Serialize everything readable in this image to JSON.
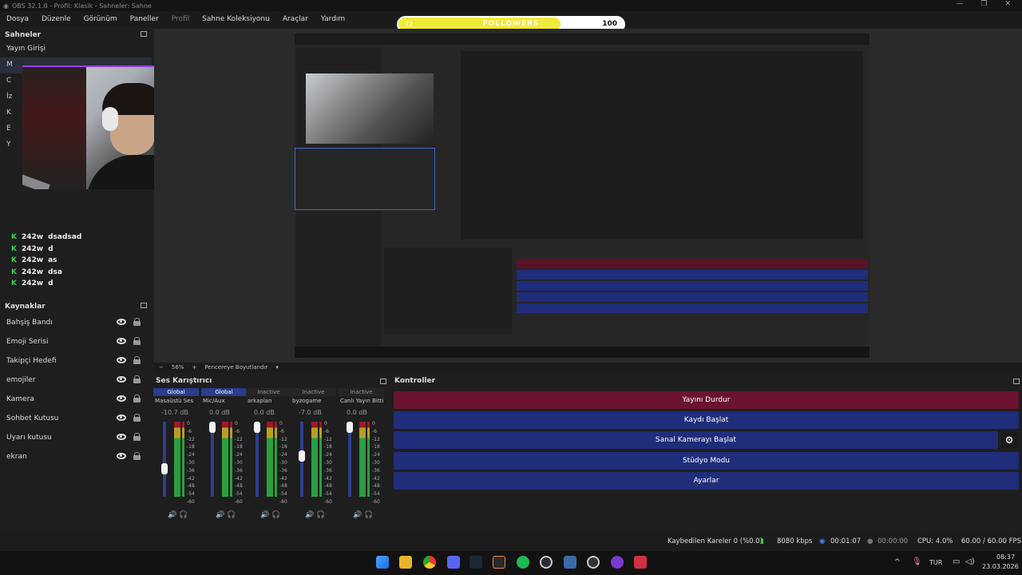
{
  "window": {
    "title": "OBS 32.1.0 - Profil: Klasik - Sahneler: Sahne",
    "controls": [
      "—",
      "❐",
      "✕"
    ]
  },
  "menu": [
    "Dosya",
    "Düzenle",
    "Görünüm",
    "Paneller",
    "Profil",
    "Sahne Koleksiyonu",
    "Araçlar",
    "Yardım"
  ],
  "followers": {
    "label": "FOLLOWERS",
    "current": "72",
    "goal": "100",
    "progress": 0.72
  },
  "scenes": {
    "title": "Sahneler",
    "items": [
      "Yayın Girişi",
      "M",
      "C",
      "İz",
      "K",
      "E",
      "Y"
    ]
  },
  "chat": [
    {
      "count": "242w",
      "text": "dsadsad"
    },
    {
      "count": "242w",
      "text": "d"
    },
    {
      "count": "242w",
      "text": "as"
    },
    {
      "count": "242w",
      "text": "dsa"
    },
    {
      "count": "242w",
      "text": "d"
    }
  ],
  "sources": {
    "title": "Kaynaklar",
    "items": [
      "Bahşiş Bandı",
      "Emoji Serisi",
      "Takipçi Hedefi",
      "emojiler",
      "Kamera",
      "Sohbet Kutusu",
      "Uyarı kutusu",
      "ekran"
    ]
  },
  "zoom": {
    "value": "56%",
    "fit_label": "Pencereye Boyutlandır"
  },
  "mixer": {
    "title": "Ses Karıştırıcı",
    "ticks": [
      "0",
      "-6",
      "-12",
      "-18",
      "-24",
      "-30",
      "-36",
      "-42",
      "-48",
      "-54",
      "-60"
    ],
    "channels": [
      {
        "badge": "Global",
        "name": "Masaüstü Ses",
        "db": "-10.7 dB",
        "level": 0.35
      },
      {
        "badge": "Global",
        "name": "Mic/Aux",
        "db": "0.0 dB",
        "level": 1.0
      },
      {
        "badge": "Inactive",
        "name": "arkaplan",
        "db": "0.0 dB",
        "level": 1.0
      },
      {
        "badge": "Inactive",
        "name": "byzogame",
        "db": "-7.0 dB",
        "level": 0.55
      },
      {
        "badge": "Inactive",
        "name": "Canlı Yayın Bitti",
        "db": "0.0 dB",
        "level": 1.0
      }
    ]
  },
  "controls": {
    "title": "Kontroller",
    "buttons": [
      "Yayını Durdur",
      "Kaydı Başlat",
      "Sanal Kamerayı Başlat",
      "Stüdyo Modu",
      "Ayarlar"
    ],
    "colors": {
      "stop": "#6b1330",
      "normal": "#1f2d7a"
    }
  },
  "status": {
    "dropped": "Kaybedilen Kareler 0 (%0.0)",
    "bitrate": "8080 kbps",
    "stream_time": "00:01:07",
    "rec_time": "00:00:00",
    "cpu": "CPU: 4.0%",
    "fps": "60.00 / 60.00 FPS"
  },
  "taskbar": {
    "lang": "TUR",
    "time": "08:37",
    "date": "23.03.2026"
  }
}
